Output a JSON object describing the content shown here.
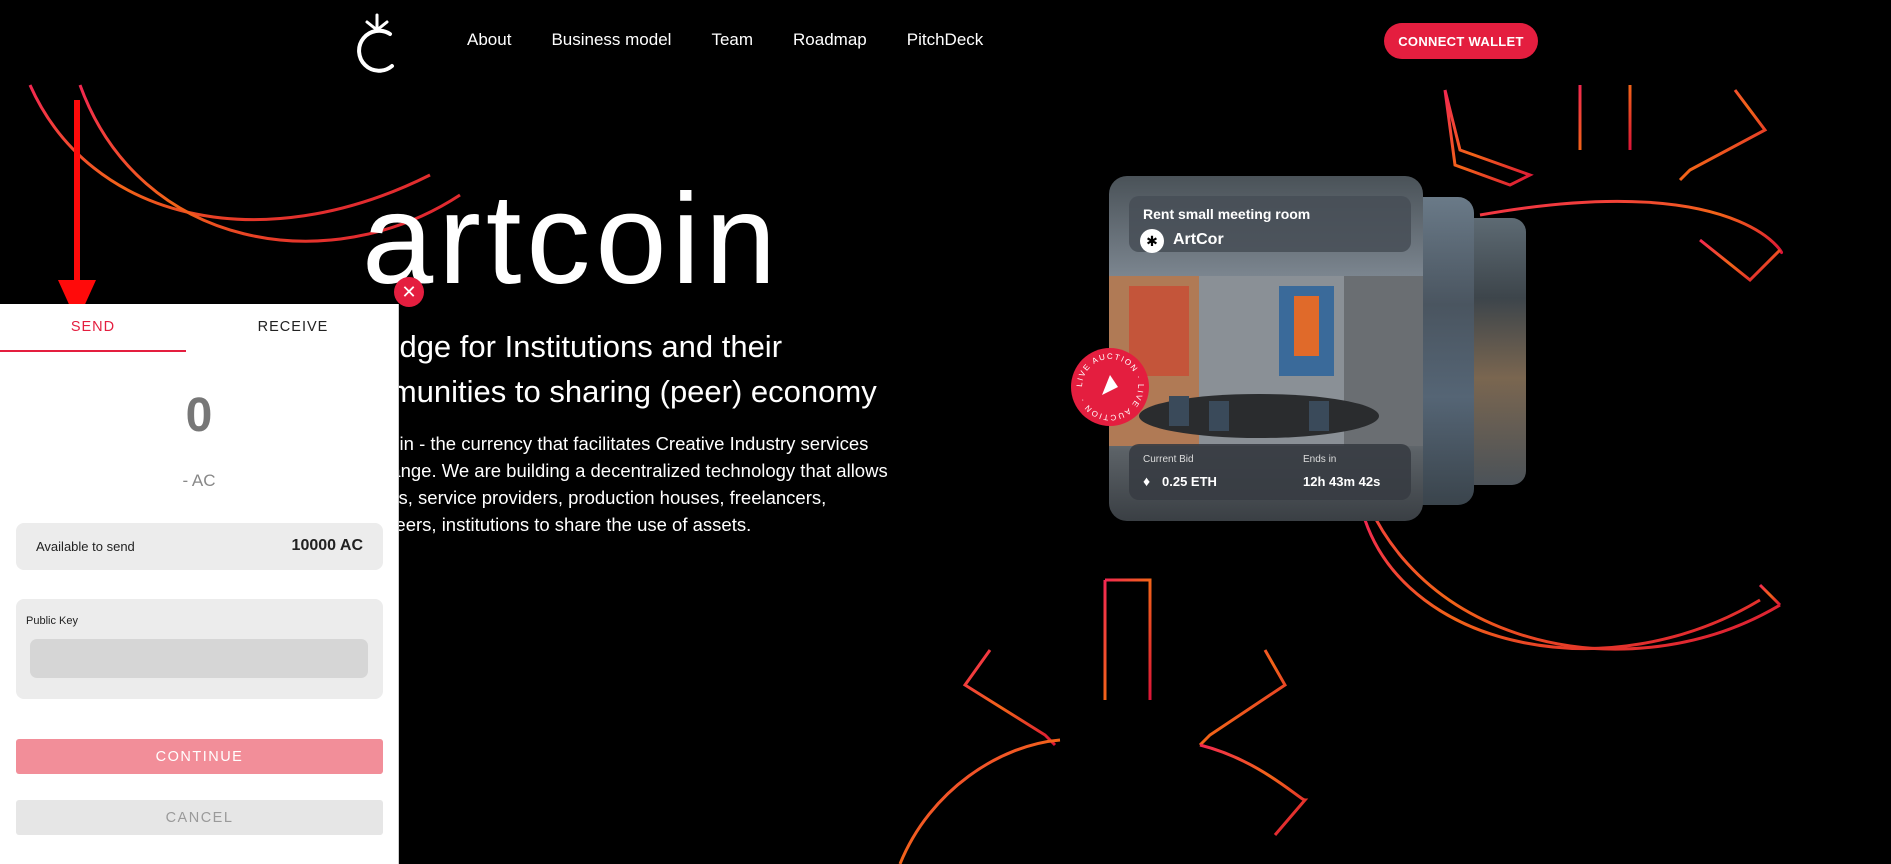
{
  "header": {
    "logo_icon": "artcoin-logo-icon",
    "nav": [
      "About",
      "Business model",
      "Team",
      "Roadmap",
      "PitchDeck"
    ],
    "connect_wallet": "CONNECT WALLET"
  },
  "hero": {
    "title": "artcoin",
    "subtitle_line1": "bridge for Institutions and their",
    "subtitle_line2": "mmunities to sharing (peer) economy",
    "desc_line1": "coin - the currency that facilitates Creative Industry services",
    "desc_line2": "hange. We are building a decentralized technology that allows",
    "desc_line3": "ists, service providers, production houses, freelancers,",
    "desc_line4": "nteers, institutions to share the use of assets."
  },
  "card": {
    "title": "Rent small meeting room",
    "org": "ArtCor",
    "current_bid_label": "Current Bid",
    "current_bid_value": "0.25 ETH",
    "ends_label": "Ends in",
    "ends_value": "12h  43m  42s",
    "badge_text": "LIVE AUCTION · LIVE AUCTION ·"
  },
  "wallet": {
    "tabs": {
      "send": "SEND",
      "receive": "RECEIVE"
    },
    "active_tab": "send",
    "amount": "0",
    "unit": "- AC",
    "available_label": "Available to send",
    "available_value": "10000 AC",
    "public_key_label": "Public Key",
    "public_key_value": "",
    "continue": "CONTINUE",
    "cancel": "CANCEL",
    "close_icon": "close-icon"
  },
  "colors": {
    "accent": "#e41e3f",
    "background": "#000000",
    "panel": "#ffffff",
    "continue_disabled": "#f28e99"
  }
}
